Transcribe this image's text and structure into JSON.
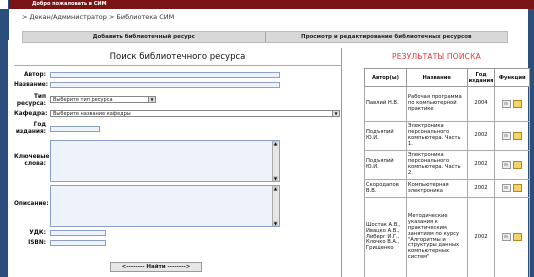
{
  "window": {
    "title": "Добро пожаловать в СИМ"
  },
  "breadcrumb": {
    "text": "> Декан/Администратор > Библиотека СИМ"
  },
  "nav": {
    "add_label": "Добавить библиотечный ресурс",
    "view_label": "Просмотр и редактирование библиотечных ресурсов"
  },
  "search_form": {
    "title": "Поиск библиотечного ресурса",
    "author_label": "Автор:",
    "author_value": "",
    "name_label": "Название:",
    "name_value": "",
    "type_label": "Тип ресурса:",
    "type_value": "Выберите тип ресурса",
    "dept_label": "Кафедра:",
    "dept_value": "Выберите название кафедры",
    "year_label": "Год издания:",
    "year_value": "",
    "keywords_label": "Ключевые слова:",
    "keywords_value": "",
    "desc_label": "Описание:",
    "desc_value": "",
    "udk_label": "УДК:",
    "udk_value": "",
    "isbn_label": "ISBN:",
    "isbn_value": "",
    "find_label": "<-------- Найти -------->"
  },
  "results": {
    "title": "РЕЗУЛЬТАТЫ ПОИСКА",
    "columns": [
      "Автор(ы)",
      "Название",
      "Год издания",
      "Функции"
    ],
    "rows": [
      {
        "author": "Павлий Н.В.",
        "title": "Рабочая программа по компьютерной практике",
        "year": "2004"
      },
      {
        "author": "Подъяпий Ю.И.",
        "title": "Электроника персонального компьютера. Часть 1.",
        "year": "2002"
      },
      {
        "author": "Подъяпий Ю.И.",
        "title": "Электроника персонального компьютера. Часть 2.",
        "year": "2002"
      },
      {
        "author": "Скородапов В.В.",
        "title": "Компьютерная электроника",
        "year": "2002"
      },
      {
        "author": "Шостак А.В., Ивацко А.В., Либерг И.Г., Клочко В.А., Грищенко",
        "title": "Методические указания к практическим занятиям по курсу \"Алгоритмы и структуры данных компьютерных систем\"",
        "year": "2002"
      }
    ]
  },
  "icons": {
    "view": "view-icon",
    "folder": "folder-icon",
    "dropdown": "chevron-down-icon"
  }
}
